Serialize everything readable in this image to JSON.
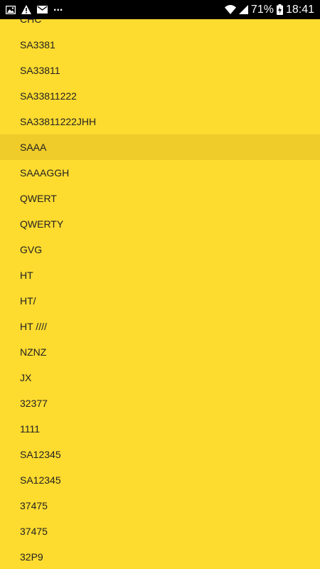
{
  "status_bar": {
    "left_icons": [
      "image-icon",
      "warning-icon",
      "mail-icon"
    ],
    "more_indicator": "...",
    "battery_percent": "71%",
    "time": "18:41",
    "right_icons": [
      "wifi-icon",
      "signal-icon",
      "battery-charging-icon"
    ]
  },
  "list": {
    "selected_index": 5,
    "items": [
      {
        "label": "CHC"
      },
      {
        "label": "SA3381"
      },
      {
        "label": "SA33811"
      },
      {
        "label": "SA33811222"
      },
      {
        "label": "SA33811222JHH"
      },
      {
        "label": "SAAA"
      },
      {
        "label": "SAAAGGH"
      },
      {
        "label": "QWERT"
      },
      {
        "label": "QWERTY"
      },
      {
        "label": "GVG"
      },
      {
        "label": "HT"
      },
      {
        "label": "HT/"
      },
      {
        "label": "HT ////"
      },
      {
        "label": "NZNZ"
      },
      {
        "label": "JX"
      },
      {
        "label": "32377"
      },
      {
        "label": "1111"
      },
      {
        "label": "SA12345"
      },
      {
        "label": "SA12345"
      },
      {
        "label": "37475"
      },
      {
        "label": "37475"
      },
      {
        "label": "32P9"
      }
    ]
  },
  "colors": {
    "background": "#FDDB2F",
    "selected_row": "#EFCC2A",
    "text": "#222222",
    "status_bar": "#000000"
  }
}
